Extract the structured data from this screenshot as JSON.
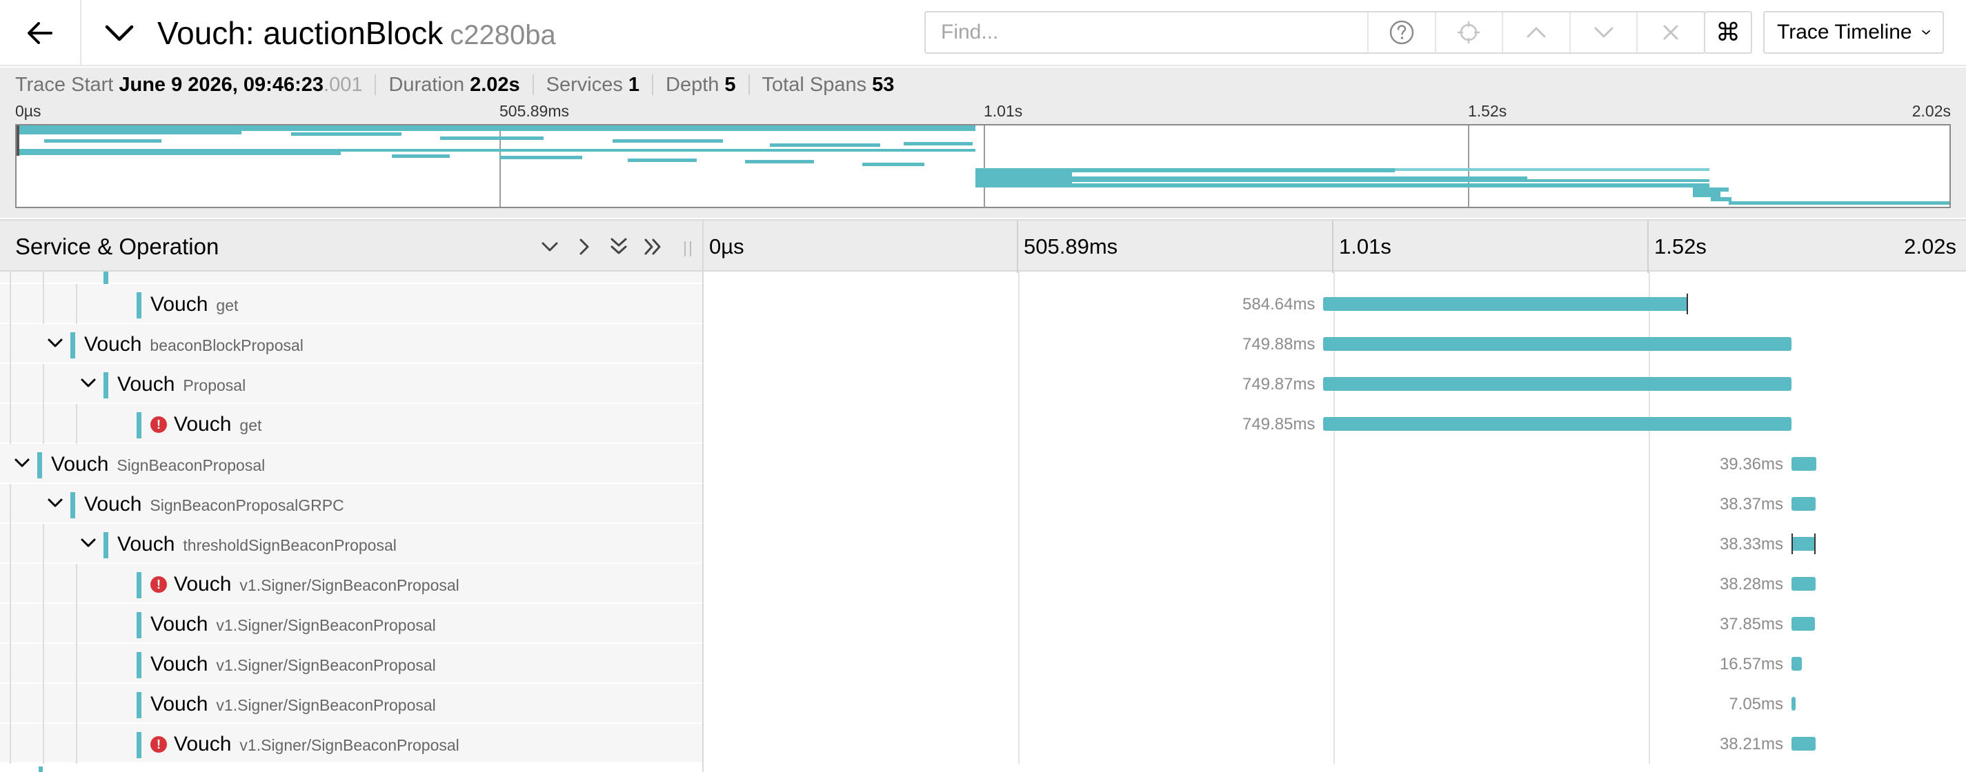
{
  "header": {
    "title": "Vouch: auctionBlock",
    "trace_id": "c2280ba",
    "find_placeholder": "Find...",
    "view_label": "Trace Timeline",
    "cmd_glyph": "⌘"
  },
  "summary": {
    "trace_start_label": "Trace Start",
    "trace_start_value": "June 9 2026, 09:46:23",
    "trace_start_ms": ".001",
    "duration_label": "Duration",
    "duration_value": "2.02s",
    "services_label": "Services",
    "services_value": "1",
    "depth_label": "Depth",
    "depth_value": "5",
    "total_spans_label": "Total Spans",
    "total_spans_value": "53"
  },
  "ticks": [
    "0µs",
    "505.89ms",
    "1.01s",
    "1.52s",
    "2.02s"
  ],
  "main": {
    "column_title": "Service & Operation"
  },
  "colors": {
    "span": "#5bbbc4",
    "error": "#d6333b"
  },
  "rows": [
    {
      "depth": 4,
      "expandable": false,
      "error": false,
      "service": "Vouch",
      "operation": "get",
      "duration": "584.64ms",
      "start_frac": 0.4915,
      "dur_frac": 0.2894
    },
    {
      "depth": 2,
      "expandable": true,
      "error": false,
      "service": "Vouch",
      "operation": "beaconBlockProposal",
      "duration": "749.88ms",
      "start_frac": 0.4915,
      "dur_frac": 0.3712
    },
    {
      "depth": 3,
      "expandable": true,
      "error": false,
      "service": "Vouch",
      "operation": "Proposal",
      "duration": "749.87ms",
      "start_frac": 0.4915,
      "dur_frac": 0.3712
    },
    {
      "depth": 4,
      "expandable": false,
      "error": true,
      "service": "Vouch",
      "operation": "get",
      "duration": "749.85ms",
      "start_frac": 0.4915,
      "dur_frac": 0.3712
    },
    {
      "depth": 1,
      "expandable": true,
      "error": false,
      "service": "Vouch",
      "operation": "SignBeaconProposal",
      "duration": "39.36ms",
      "start_frac": 0.8627,
      "dur_frac": 0.0195
    },
    {
      "depth": 2,
      "expandable": true,
      "error": false,
      "service": "Vouch",
      "operation": "SignBeaconProposalGRPC",
      "duration": "38.37ms",
      "start_frac": 0.8627,
      "dur_frac": 0.019
    },
    {
      "depth": 3,
      "expandable": true,
      "error": false,
      "service": "Vouch",
      "operation": "thresholdSignBeaconProposal",
      "duration": "38.33ms",
      "start_frac": 0.8627,
      "dur_frac": 0.019
    },
    {
      "depth": 4,
      "expandable": false,
      "error": true,
      "service": "Vouch",
      "operation": "v1.Signer/SignBeaconProposal",
      "duration": "38.28ms",
      "start_frac": 0.8627,
      "dur_frac": 0.019
    },
    {
      "depth": 4,
      "expandable": false,
      "error": false,
      "service": "Vouch",
      "operation": "v1.Signer/SignBeaconProposal",
      "duration": "37.85ms",
      "start_frac": 0.8627,
      "dur_frac": 0.0187
    },
    {
      "depth": 4,
      "expandable": false,
      "error": false,
      "service": "Vouch",
      "operation": "v1.Signer/SignBeaconProposal",
      "duration": "16.57ms",
      "start_frac": 0.8627,
      "dur_frac": 0.0082
    },
    {
      "depth": 4,
      "expandable": false,
      "error": false,
      "service": "Vouch",
      "operation": "v1.Signer/SignBeaconProposal",
      "duration": "7.05ms",
      "start_frac": 0.8627,
      "dur_frac": 0.0035
    },
    {
      "depth": 4,
      "expandable": false,
      "error": true,
      "service": "Vouch",
      "operation": "v1.Signer/SignBeaconProposal",
      "duration": "38.21ms",
      "start_frac": 0.8627,
      "dur_frac": 0.019
    }
  ]
}
